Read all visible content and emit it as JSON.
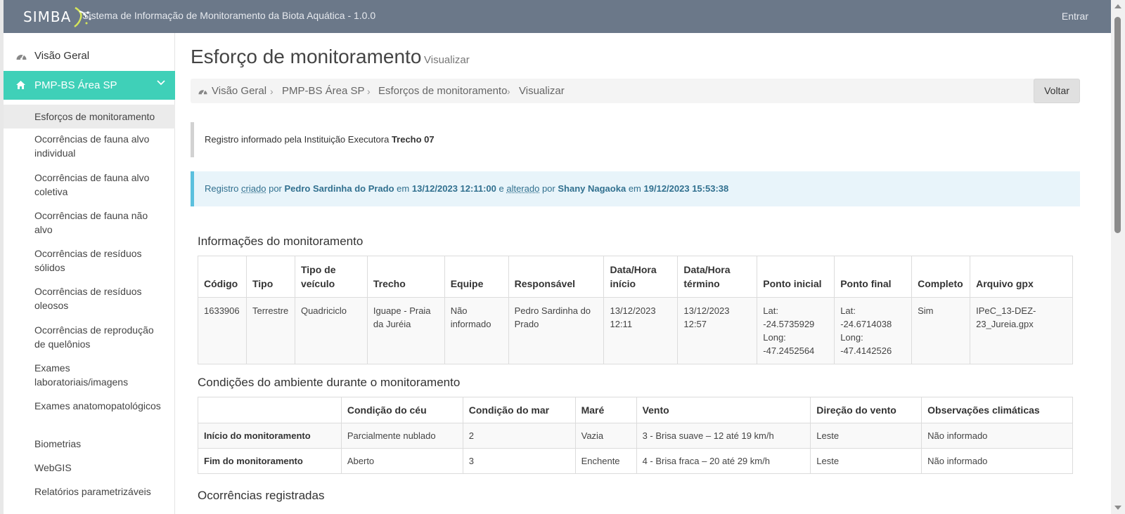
{
  "header": {
    "logo_text": "SIMBA",
    "app_title": "Sistema de Informação de Monitoramento da Biota Aquática - 1.0.0",
    "login_label": "Entrar"
  },
  "sidebar": {
    "overview_label": "Visão Geral",
    "active_section": {
      "label": "PMP-BS Área SP",
      "color": "#3fd0b8"
    },
    "items": [
      {
        "label": "Esforços de monitoramento",
        "selected": true
      },
      {
        "label": "Ocorrências de fauna alvo individual"
      },
      {
        "label": "Ocorrências de fauna alvo coletiva"
      },
      {
        "label": "Ocorrências de fauna não alvo"
      },
      {
        "label": "Ocorrências de resíduos sólidos"
      },
      {
        "label": "Ocorrências de resíduos oleosos"
      },
      {
        "label": "Ocorrências de reprodução de quelônios"
      },
      {
        "label": "Exames laboratoriais/imagens"
      },
      {
        "label": "Exames anatomopatológicos"
      },
      {
        "label": "Biometrias"
      },
      {
        "label": "WebGIS"
      },
      {
        "label": "Relatórios parametrizáveis"
      }
    ]
  },
  "page": {
    "title": "Esforço de monitoramento",
    "subtitle": "Visualizar",
    "back_label": "Voltar"
  },
  "breadcrumb": [
    "Visão Geral",
    "PMP-BS Área SP",
    "Esforços de monitoramento",
    "Visualizar"
  ],
  "notice_institution": {
    "text": "Registro informado pela Instituição Executora",
    "value": "Trecho 07"
  },
  "notice_audit": {
    "prefix": "Registro",
    "created_word": "criado",
    "by1": "por",
    "creator": "Pedro Sardinha do Prado",
    "on1": "em",
    "created_at": "13/12/2023 12:11:00",
    "and": "e",
    "altered_word": "alterado",
    "by2": "por",
    "editor": "Shany Nagaoka",
    "on2": "em",
    "altered_at": "19/12/2023 15:53:38"
  },
  "monitoring": {
    "heading": "Informações do monitoramento",
    "columns": [
      "Código",
      "Tipo",
      "Tipo de veículo",
      "Trecho",
      "Equipe",
      "Responsável",
      "Data/Hora início",
      "Data/Hora término",
      "Ponto inicial",
      "Ponto final",
      "Completo",
      "Arquivo gpx"
    ],
    "row": {
      "codigo": "1633906",
      "tipo": "Terrestre",
      "veiculo": "Quadriciclo",
      "trecho": "Iguape - Praia da Juréia",
      "equipe": "Não informado",
      "responsavel": "Pedro Sardinha do Prado",
      "inicio": "13/12/2023 12:11",
      "termino": "13/12/2023 12:57",
      "ponto_inicial": {
        "lat_label": "Lat:",
        "lat": "-24.5735929",
        "long_label": "Long:",
        "long": "-47.2452564"
      },
      "ponto_final": {
        "lat_label": "Lat:",
        "lat": "-24.6714038",
        "long_label": "Long:",
        "long": "-47.4142526"
      },
      "completo": "Sim",
      "gpx": "IPeC_13-DEZ-23_Jureia.gpx"
    }
  },
  "environment": {
    "heading": "Condições do ambiente durante o monitoramento",
    "columns": [
      "",
      "Condição do céu",
      "Condição do mar",
      "Maré",
      "Vento",
      "Direção do vento",
      "Observações climáticas"
    ],
    "rows": [
      [
        "Início do monitoramento",
        "Parcialmente nublado",
        "2",
        "Vazia",
        "3 - Brisa suave – 12 até 19 km/h",
        "Leste",
        "Não informado"
      ],
      [
        "Fim do monitoramento",
        "Aberto",
        "3",
        "Enchente",
        "4 - Brisa fraca – 20 até 29 km/h",
        "Leste",
        "Não informado"
      ]
    ]
  },
  "occurrences": {
    "heading": "Ocorrências registradas"
  }
}
